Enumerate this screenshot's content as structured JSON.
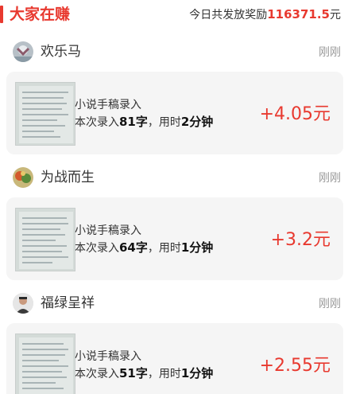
{
  "header": {
    "title": "大家在赚",
    "reward_prefix": "今日共发放奖励",
    "reward_amount": "116371.5",
    "reward_unit": "元"
  },
  "colors": {
    "accent": "#e8392f",
    "card_bg": "#f5f5f5",
    "muted": "#999999"
  },
  "entries": [
    {
      "user": "欢乐马",
      "avatar_icon": "user-avatar-icon",
      "time": "刚刚",
      "task": "小说手稿录入",
      "detail_prefix": "本次录入",
      "chars": "81字",
      "detail_mid": "，用时",
      "duration": "2分钟",
      "reward": "+4.05元"
    },
    {
      "user": "为战而生",
      "avatar_icon": "user-avatar-icon",
      "time": "刚刚",
      "task": "小说手稿录入",
      "detail_prefix": "本次录入",
      "chars": "64字",
      "detail_mid": "，用时",
      "duration": "1分钟",
      "reward": "+3.2元"
    },
    {
      "user": "福绿呈祥",
      "avatar_icon": "user-avatar-icon",
      "time": "刚刚",
      "task": "小说手稿录入",
      "detail_prefix": "本次录入",
      "chars": "51字",
      "detail_mid": "，用时",
      "duration": "1分钟",
      "reward": "+2.55元"
    }
  ]
}
